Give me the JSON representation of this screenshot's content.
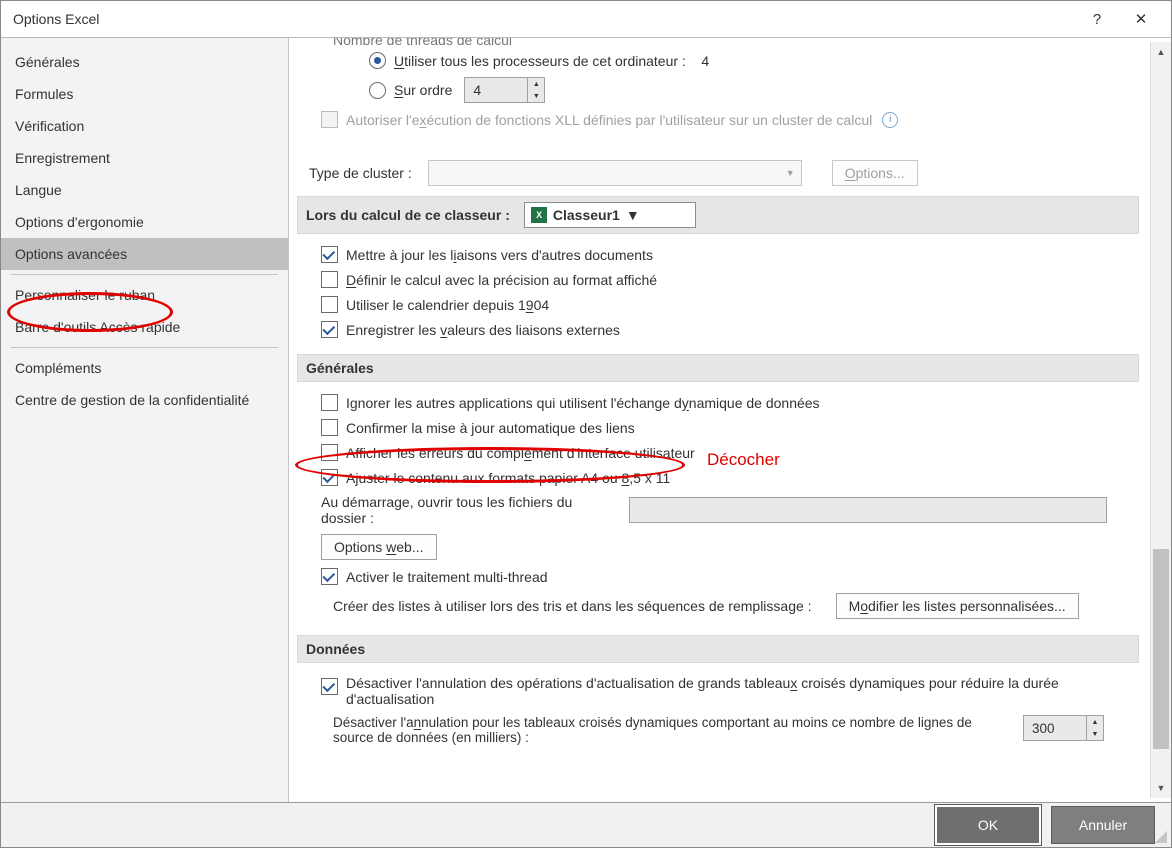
{
  "titlebar": {
    "title": "Options Excel",
    "help": "?",
    "close": "✕"
  },
  "sidebar": {
    "items": [
      {
        "label": "Générales"
      },
      {
        "label": "Formules"
      },
      {
        "label": "Vérification"
      },
      {
        "label": "Enregistrement"
      },
      {
        "label": "Langue"
      },
      {
        "label": "Options d'ergonomie"
      },
      {
        "label": "Options avancées",
        "selected": true
      },
      {
        "label": "Personnaliser le ruban"
      },
      {
        "label": "Barre d'outils Accès rapide"
      },
      {
        "label": "Compléments"
      },
      {
        "label": "Centre de gestion de la confidentialité"
      }
    ]
  },
  "threads_section": {
    "cut_label": "Nombre de threads de calcul",
    "use_all_label_pre": "U",
    "use_all_label": "tiliser tous les processeurs de cet ordinateur :",
    "use_all_value": "4",
    "on_order_pre": "S",
    "on_order_label": "ur ordre",
    "on_order_value": "4",
    "xll_label_pre": "Autoriser l'e",
    "xll_underline": "x",
    "xll_label_post": "écution de fonctions XLL définies par l'utilisateur sur un cluster de calcul",
    "cluster_type_label": "Type de cluster :",
    "cluster_options_btn_pre": "O",
    "cluster_options_btn": "ptions..."
  },
  "workbook_calc": {
    "header": "Lors du calcul de ce classeur :",
    "workbook_name": "Classeur1",
    "opt1": "Mettre à jour les l",
    "opt1_u": "i",
    "opt1_post": "aisons vers d'autres documents",
    "opt2_u": "D",
    "opt2": "éfinir le calcul avec la précision au format affiché",
    "opt3_pre": "Utiliser le calendrier depuis 1",
    "opt3_u": "9",
    "opt3_post": "04",
    "opt4_pre": "Enregistrer les ",
    "opt4_u": "v",
    "opt4_post": "aleurs des liaisons externes"
  },
  "general": {
    "header": "Générales",
    "opt1_pre": "Ignorer les autres applications qui utilisent l'échange d",
    "opt1_u": "y",
    "opt1_post": "namique de données",
    "opt2": "Confirmer la mise à jour automatique des liens",
    "opt3_pre": "Afficher les erreurs du compl",
    "opt3_u": "é",
    "opt3_post": "ment d'interface utilisateur",
    "opt4_pre": "Ajuster le contenu aux formats papier A4 ou ",
    "opt4_u": "8",
    "opt4_post": ",5 x 11",
    "startup_label": "Au démarrage, ouvrir tous les fichiers du dossier :",
    "web_btn_pre": "Options ",
    "web_btn_u": "w",
    "web_btn_post": "eb...",
    "opt5": "Activer le traitement multi-thread",
    "custom_lists_label": "Créer des listes à utiliser lors des tris et dans les séquences de remplissage :",
    "custom_lists_btn_pre": "M",
    "custom_lists_btn_u": "o",
    "custom_lists_btn_post": "difier les listes personnalisées..."
  },
  "data": {
    "header": "Données",
    "opt1_pre": "Désactiver l'annulation des opérations d'actualisation de grands tableau",
    "opt1_u": "x",
    "opt1_post": " croisés dynamiques pour réduire la durée d'actualisation",
    "opt2_pre": "Désactiver l'a",
    "opt2_u": "n",
    "opt2_post": "nulation pour les tableaux croisés dynamiques comportant au moins ce nombre de lignes de source de données (en milliers) :",
    "opt2_value": "300"
  },
  "annotation": "Décocher",
  "footer": {
    "ok": "OK",
    "cancel": "Annuler"
  }
}
